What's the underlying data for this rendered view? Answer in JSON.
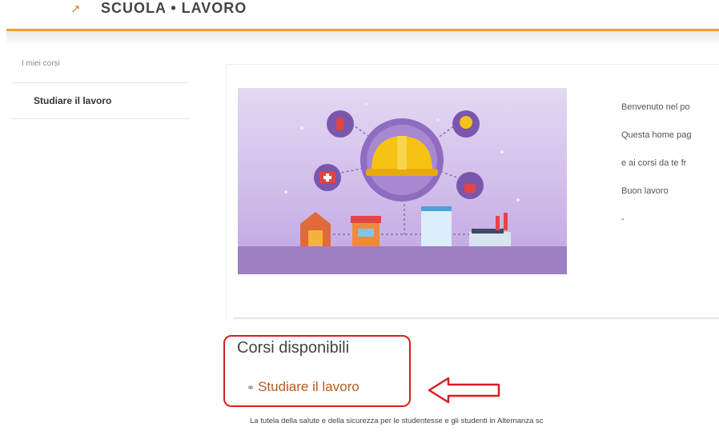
{
  "header": {
    "title": "SCUOLA • LAVORO"
  },
  "sidebar": {
    "heading": "I miei corsi",
    "items": [
      {
        "label": "Studiare il lavoro"
      }
    ]
  },
  "main": {
    "welcome_lines": [
      "Benvenuto nel po",
      "Questa home pag",
      "e ai corsi da te fr",
      "Buon lavoro",
      "-"
    ],
    "courses_heading": "Corsi disponibili",
    "course": {
      "title": "Studiare il lavoro",
      "description": "La tutela della salute e della sicurezza per le studentesse e gli studenti in Alternanza sc"
    }
  },
  "colors": {
    "accent": "#f0a030",
    "course_link": "#b85a1a",
    "highlight": "#d42020",
    "banner_bg": "#c9b2e6"
  },
  "icons": [
    "helmet-icon",
    "fire-extinguisher-icon",
    "first-aid-icon",
    "lightbulb-icon",
    "lock-icon",
    "warehouse-icon",
    "shop-icon",
    "office-building-icon",
    "factory-icon",
    "course-icon"
  ]
}
